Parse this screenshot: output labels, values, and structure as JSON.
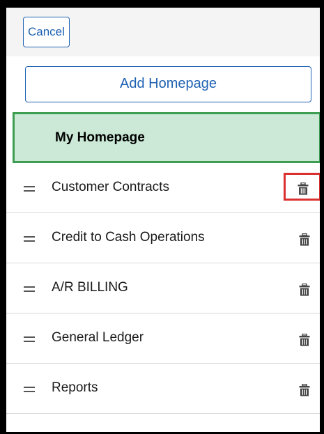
{
  "topbar": {
    "cancel_label": "Cancel"
  },
  "add_homepage_label": "Add Homepage",
  "my_homepage_label": "My Homepage",
  "homepages": [
    {
      "label": "Customer Contracts",
      "highlighted_delete": true
    },
    {
      "label": "Credit to Cash Operations",
      "highlighted_delete": false
    },
    {
      "label": "A/R BILLING",
      "highlighted_delete": false
    },
    {
      "label": "General Ledger",
      "highlighted_delete": false
    },
    {
      "label": "Reports",
      "highlighted_delete": false
    }
  ],
  "icons": {
    "drag": "drag-handle-icon",
    "delete": "trash-icon"
  },
  "colors": {
    "accent": "#1f61b2",
    "selected_bg": "#cbe9d6",
    "selected_border": "#3d9e52",
    "highlight": "#d93030"
  }
}
